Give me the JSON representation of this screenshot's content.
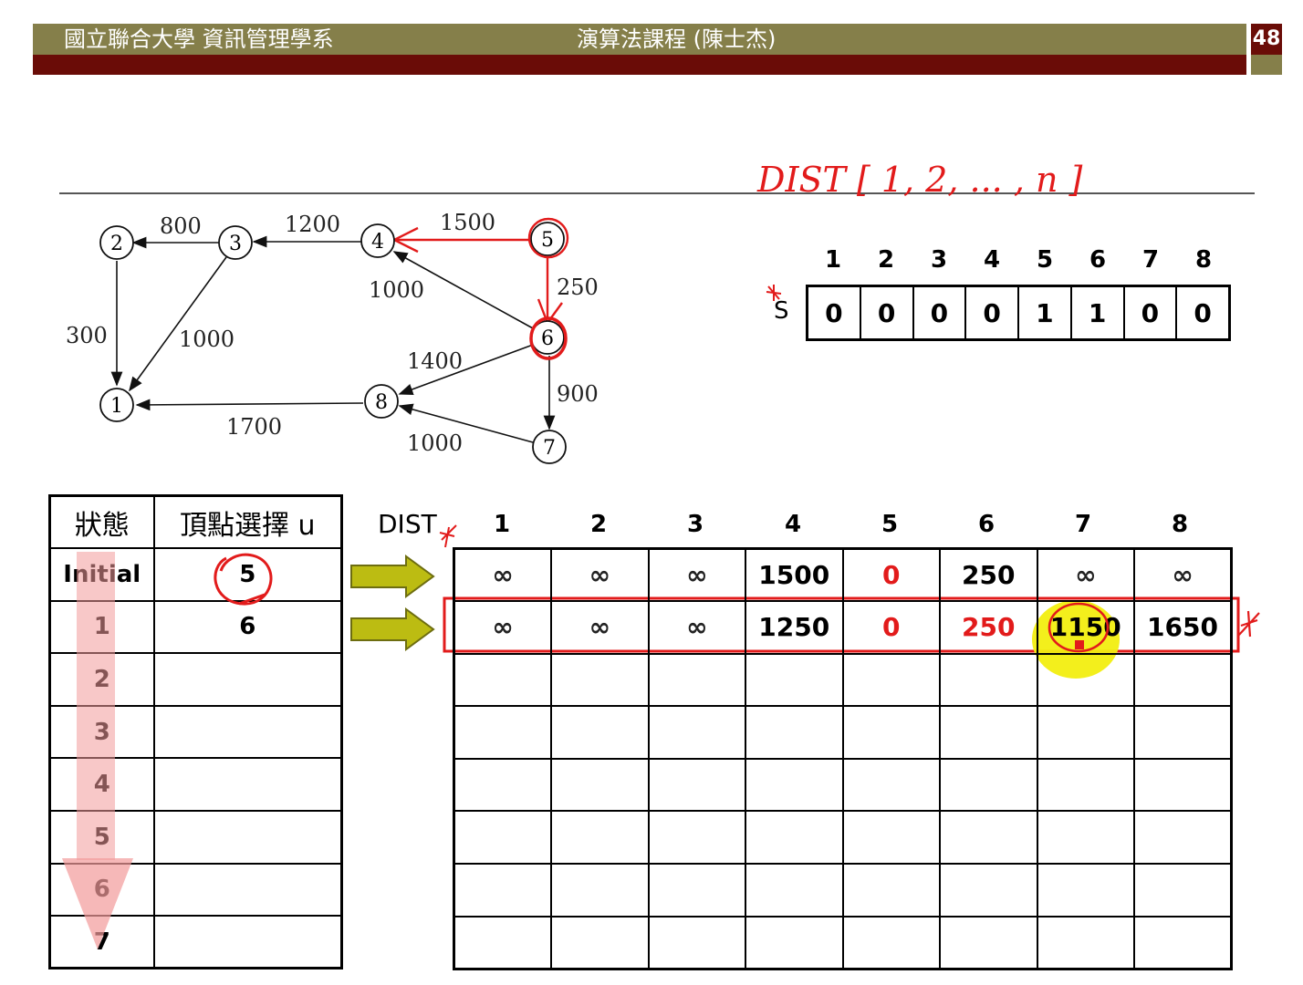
{
  "header": {
    "department": "國立聯合大學 資訊管理學系",
    "course": "演算法課程 (陳士杰)",
    "page_number": "48"
  },
  "annotation": {
    "dist_note": "DIST [ 1, 2, ... , n ]"
  },
  "graph": {
    "vertices": [
      "1",
      "2",
      "3",
      "4",
      "5",
      "6",
      "7",
      "8"
    ],
    "edge_labels": {
      "e32": "800",
      "e43": "1200",
      "e54": "1500",
      "e21": "300",
      "e31": "1000",
      "e64": "1000",
      "e56": "250",
      "e68": "1400",
      "e67": "900",
      "e81": "1700",
      "e78": "1000"
    }
  },
  "s_array": {
    "name": "S",
    "indices": [
      "1",
      "2",
      "3",
      "4",
      "5",
      "6",
      "7",
      "8"
    ],
    "values": [
      "0",
      "0",
      "0",
      "0",
      "1",
      "1",
      "0",
      "0"
    ]
  },
  "state_table": {
    "headers": [
      "狀態",
      "頂點選擇 u"
    ],
    "rows": [
      [
        "Initial",
        "5"
      ],
      [
        "1",
        "6"
      ],
      [
        "2",
        ""
      ],
      [
        "3",
        ""
      ],
      [
        "4",
        ""
      ],
      [
        "5",
        ""
      ],
      [
        "6",
        ""
      ],
      [
        "7",
        ""
      ]
    ]
  },
  "dist_table": {
    "label": "DIST",
    "indices": [
      "1",
      "2",
      "3",
      "4",
      "5",
      "6",
      "7",
      "8"
    ],
    "rows": [
      [
        "∞",
        "∞",
        "∞",
        "1500",
        "0",
        "250",
        "∞",
        "∞"
      ],
      [
        "∞",
        "∞",
        "∞",
        "1250",
        "0",
        "250",
        "1150",
        "1650"
      ],
      [
        "",
        "",
        "",
        "",
        "",
        "",
        "",
        ""
      ],
      [
        "",
        "",
        "",
        "",
        "",
        "",
        "",
        ""
      ],
      [
        "",
        "",
        "",
        "",
        "",
        "",
        "",
        ""
      ],
      [
        "",
        "",
        "",
        "",
        "",
        "",
        "",
        ""
      ],
      [
        "",
        "",
        "",
        "",
        "",
        "",
        "",
        ""
      ],
      [
        "",
        "",
        "",
        "",
        "",
        "",
        "",
        ""
      ]
    ]
  },
  "colors": {
    "header_olive": "#857f4a",
    "header_maroon": "#6a0c07",
    "annotation_red": "#e21b1b",
    "highlight_yellow": "#f2ee10",
    "arrow_olive": "#bcbc12"
  }
}
